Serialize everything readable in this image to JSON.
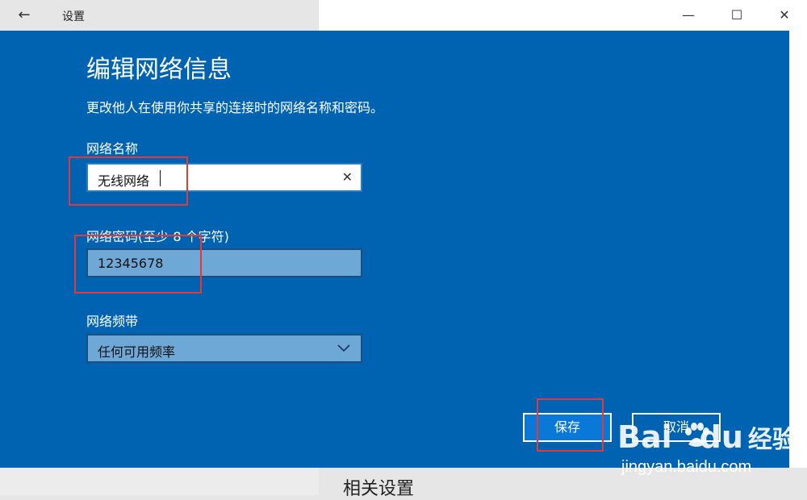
{
  "window": {
    "title": "设置",
    "back_glyph": "←",
    "minimize_glyph": "—",
    "maximize_glyph": "☐",
    "close_glyph": "✕"
  },
  "dialog": {
    "title": "编辑网络信息",
    "description": "更改他人在使用你共享的连接时的网络名称和密码。",
    "network_name": {
      "label": "网络名称",
      "value": "无线网络",
      "clear_glyph": "✕"
    },
    "network_password": {
      "label": "网络密码(至少 8 个字符)",
      "value": "12345678"
    },
    "network_band": {
      "label": "网络频带",
      "selected": "任何可用频率"
    },
    "save_label": "保存",
    "cancel_label": "取消"
  },
  "footer": {
    "related_settings": "相关设置"
  },
  "watermark": {
    "logo_text": "Bai",
    "logo_text2": "du",
    "cn_text": "经验",
    "url": "jingyan.baidu.com"
  },
  "colors": {
    "dialog_bg": "#0063b1",
    "annotation_red": "#e23a3a"
  }
}
